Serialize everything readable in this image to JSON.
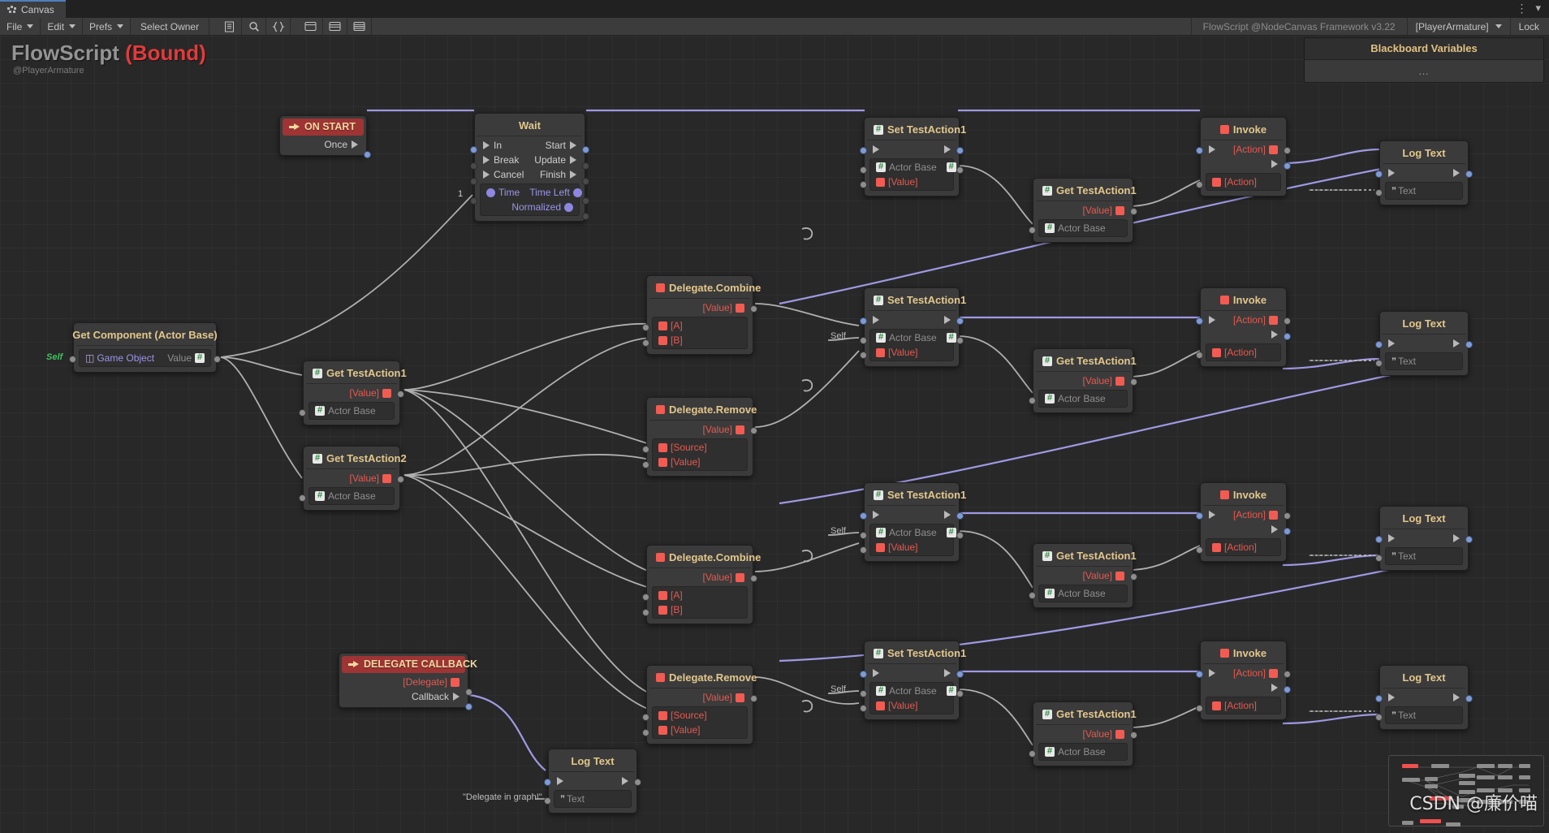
{
  "window": {
    "tab_label": "Canvas",
    "tab_icon": "canvas-dots-icon",
    "kebab": "⋮",
    "collapse": "▾"
  },
  "toolbar": {
    "file": "File",
    "edit": "Edit",
    "prefs": "Prefs",
    "select_owner": "Select Owner",
    "icons": [
      "document-icon",
      "search-icon",
      "braces-icon",
      "panel-top-icon",
      "panel-split-icon",
      "panel-list-icon"
    ],
    "framework_label": "FlowScript @NodeCanvas Framework v3.22",
    "owner": "[PlayerArmature]",
    "lock": "Lock"
  },
  "graph": {
    "title": "FlowScript",
    "title_suffix": "(Bound)",
    "subtitle": "@PlayerArmature"
  },
  "blackboard": {
    "title": "Blackboard Variables",
    "empty": "…"
  },
  "labels": {
    "self": "Self",
    "one": "1",
    "delegate_text": "\"Delegate in graph!\"",
    "dashes": "-----------------"
  },
  "nodes": {
    "on_start": {
      "title": "ON START",
      "out_once": "Once"
    },
    "wait": {
      "title": "Wait",
      "in": "In",
      "break": "Break",
      "cancel": "Cancel",
      "time": "Time",
      "start": "Start",
      "update": "Update",
      "finish": "Finish",
      "time_left": "Time Left",
      "normalized": "Normalized"
    },
    "get_component": {
      "title": "Get Component (Actor Base)",
      "game_object": "Game Object",
      "value": "Value"
    },
    "get_testaction1": {
      "title": "Get TestAction1",
      "value": "[Value]",
      "actor_base": "Actor Base"
    },
    "get_testaction2": {
      "title": "Get TestAction2",
      "value": "[Value]",
      "actor_base": "Actor Base"
    },
    "delegate_combine": {
      "title": "Delegate.Combine",
      "value": "[Value]",
      "a": "[A]",
      "b": "[B]"
    },
    "delegate_remove": {
      "title": "Delegate.Remove",
      "value": "[Value]",
      "source": "[Source]",
      "in_value": "[Value]"
    },
    "set_testaction1": {
      "title": "Set TestAction1",
      "actor_base": "Actor Base",
      "value": "[Value]"
    },
    "invoke": {
      "title": "Invoke",
      "action_out": "[Action]",
      "action_in": "[Action]"
    },
    "log_text": {
      "title": "Log Text",
      "text": "Text"
    },
    "delegate_callback": {
      "title": "DELEGATE CALLBACK",
      "delegate": "[Delegate]",
      "callback": "Callback"
    }
  },
  "colors": {
    "accent_title": "#e2c78c",
    "event_header": "#9e3434",
    "bound_red": "#e23b3b",
    "flow_wire": "#9f99e3",
    "data_wire": "#b0b0b0",
    "value_red": "#e8584f",
    "tab_accent": "#4d7fbe"
  },
  "watermark": "CSDN @廉价喵"
}
